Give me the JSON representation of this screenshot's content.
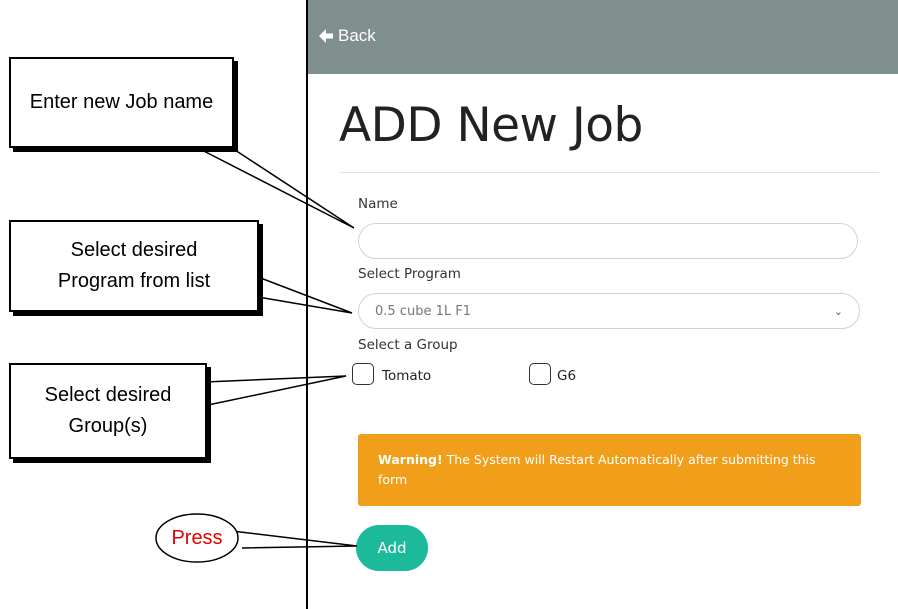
{
  "header": {
    "back_label": "Back"
  },
  "page": {
    "title": "ADD New Job"
  },
  "form": {
    "name_label": "Name",
    "name_value": "",
    "program_label": "Select Program",
    "program_selected": "0.5 cube 1L F1",
    "group_label": "Select a Group",
    "groups": [
      {
        "label": "Tomato",
        "checked": false
      },
      {
        "label": "G6",
        "checked": false
      }
    ],
    "warning_strong": "Warning!",
    "warning_text": " The System will Restart Automatically after submitting this form",
    "submit_label": "Add"
  },
  "annotations": {
    "name_callout": "Enter new Job name",
    "program_callout": "Select desired Program from list",
    "group_callout": "Select desired Group(s)",
    "press_callout": "Press"
  },
  "colors": {
    "topbar": "#7e8f8d",
    "warning": "#f19f1a",
    "submit": "#1cb99a",
    "press_text": "#e00000"
  }
}
